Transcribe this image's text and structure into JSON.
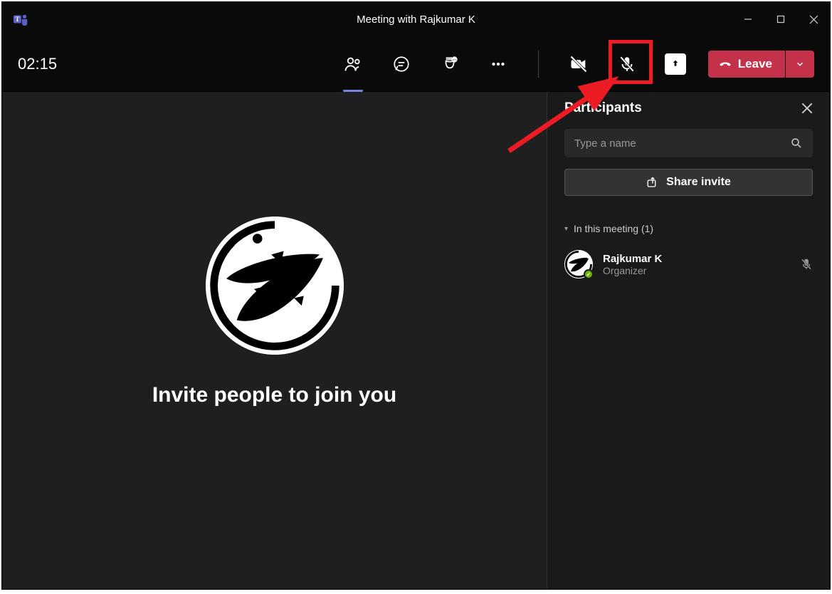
{
  "window": {
    "title": "Meeting with Rajkumar K"
  },
  "toolbar": {
    "timer": "02:15",
    "leave_label": "Leave"
  },
  "main": {
    "invite_heading": "Invite people to join you"
  },
  "panel": {
    "title": "Participants",
    "search_placeholder": "Type a name",
    "share_invite_label": "Share invite",
    "section_label": "In this meeting (1)",
    "participants": [
      {
        "name": "Rajkumar K",
        "role": "Organizer",
        "muted": true
      }
    ]
  }
}
